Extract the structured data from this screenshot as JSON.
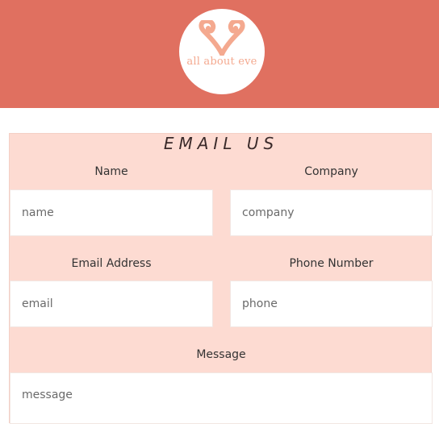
{
  "brand": {
    "logo_text": "all about eve",
    "header_color": "#e07060",
    "accent_color": "#f4a98f",
    "icon": "ram-horns-icon"
  },
  "form": {
    "title": "EMAIL US",
    "background_color": "#fddbd2",
    "fields": {
      "name": {
        "label": "Name",
        "placeholder": "name"
      },
      "company": {
        "label": "Company",
        "placeholder": "company"
      },
      "email": {
        "label": "Email Address",
        "placeholder": "email"
      },
      "phone": {
        "label": "Phone Number",
        "placeholder": "phone"
      },
      "message": {
        "label": "Message",
        "placeholder": "message"
      }
    }
  }
}
